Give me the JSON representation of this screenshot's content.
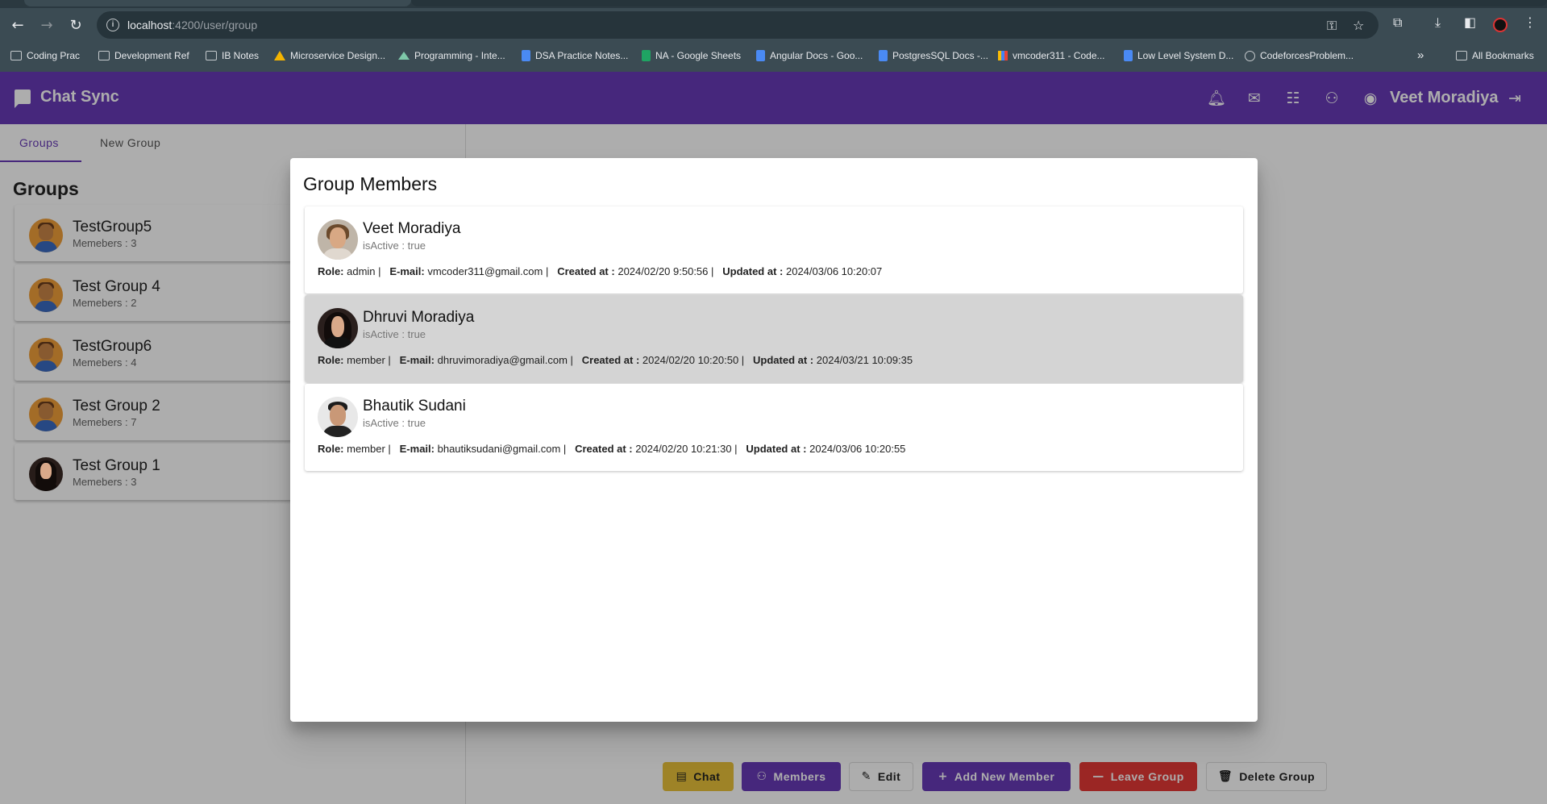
{
  "browser": {
    "url_host": "localhost",
    "url_rest": ":4200/user/group",
    "bookmarks": [
      {
        "label": "Coding Prac",
        "icon": "folder"
      },
      {
        "label": "Development Ref",
        "icon": "folder"
      },
      {
        "label": "IB Notes",
        "icon": "folder"
      },
      {
        "label": "Microservice Design...",
        "icon": "drive"
      },
      {
        "label": "Programming - Inte...",
        "icon": "mtn"
      },
      {
        "label": "DSA Practice Notes...",
        "icon": "doc"
      },
      {
        "label": "NA - Google Sheets",
        "icon": "sheet"
      },
      {
        "label": "Angular Docs - Goo...",
        "icon": "doc"
      },
      {
        "label": "PostgresSQL Docs -...",
        "icon": "doc"
      },
      {
        "label": "vmcoder311 - Code...",
        "icon": "bars"
      },
      {
        "label": "Low Level System D...",
        "icon": "doc"
      },
      {
        "label": "CodeforcesProblem...",
        "icon": "globe"
      }
    ],
    "more_bookmarks": "»",
    "all_bookmarks": "All Bookmarks"
  },
  "app": {
    "title": "Chat Sync",
    "user_name": "Veet Moradiya",
    "icons": [
      "bell-icon",
      "chat-icon",
      "contacts-icon",
      "group-icon",
      "account-icon",
      "logout-icon"
    ]
  },
  "tabs": [
    {
      "label": "Groups",
      "active": true
    },
    {
      "label": "New Group",
      "active": false
    }
  ],
  "groups": {
    "heading": "Groups",
    "items": [
      {
        "name": "TestGroup5",
        "members": "Memebers : 3"
      },
      {
        "name": "Test Group 4",
        "members": "Memebers : 2"
      },
      {
        "name": "TestGroup6",
        "members": "Memebers : 4"
      },
      {
        "name": "Test Group 2",
        "members": "Memebers : 7"
      },
      {
        "name": "Test Group 1",
        "members": "Memebers : 3"
      }
    ]
  },
  "actions": {
    "chat": "Chat",
    "members": "Members",
    "edit": "Edit",
    "add_member": "Add New Member",
    "leave": "Leave Group",
    "delete": "Delete Group"
  },
  "dialog": {
    "title": "Group Members",
    "labels": {
      "role": "Role:",
      "email": "E-mail:",
      "created": "Created at :",
      "updated": "Updated at :"
    },
    "members": [
      {
        "name": "Veet Moradiya",
        "active": "isActive : true",
        "role": "admin",
        "email": "vmcoder311@gmail.com",
        "created": "2024/02/20 9:50:56",
        "updated": "2024/03/06 10:20:07"
      },
      {
        "name": "Dhruvi Moradiya",
        "active": "isActive : true",
        "role": "member",
        "email": "dhruvimoradiya@gmail.com",
        "created": "2024/02/20 10:20:50",
        "updated": "2024/03/21 10:09:35"
      },
      {
        "name": "Bhautik Sudani",
        "active": "isActive : true",
        "role": "member",
        "email": "bhautiksudani@gmail.com",
        "created": "2024/02/20 10:21:30",
        "updated": "2024/03/06 10:20:55"
      }
    ]
  },
  "colors": {
    "primary": "#673ab7",
    "chat_button": "#e9c23a",
    "leave_button": "#e53935"
  }
}
